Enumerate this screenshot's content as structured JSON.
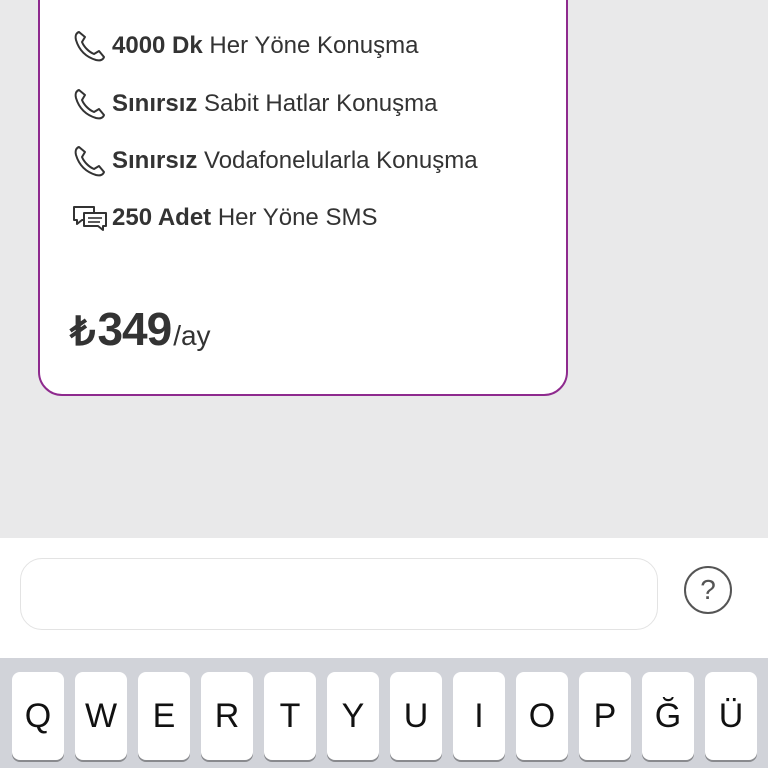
{
  "plan_card": {
    "features": [
      {
        "icon": "phone-icon",
        "bold": "4000 Dk",
        "rest": " Her Yöne Konuşma"
      },
      {
        "icon": "phone-icon",
        "bold": "Sınırsız",
        "rest": " Sabit Hatlar Konuşma"
      },
      {
        "icon": "phone-icon",
        "bold": "Sınırsız",
        "rest": " Vodafonelularla Konuşma"
      },
      {
        "icon": "chat-icon",
        "bold": "250 Adet",
        "rest": " Her Yöne SMS"
      }
    ],
    "price": {
      "currency": "₺",
      "amount": "349",
      "period": "/ay"
    }
  },
  "input": {
    "value": "",
    "placeholder": ""
  },
  "help_button": {
    "label": "?"
  },
  "keyboard": {
    "row1": [
      "Q",
      "W",
      "E",
      "R",
      "T",
      "Y",
      "U",
      "I",
      "O",
      "P",
      "Ğ",
      "Ü"
    ]
  },
  "colors": {
    "card_border": "#8e2a8e",
    "background": "#e9e9ea",
    "keyboard_bg": "#d1d3d9"
  }
}
